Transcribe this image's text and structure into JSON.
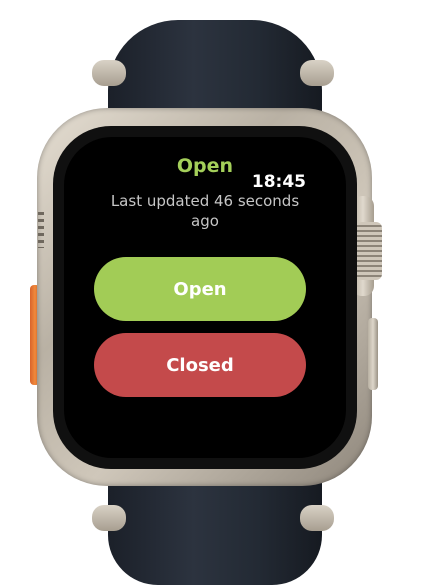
{
  "status": {
    "title": "Open",
    "clock": "18:45",
    "last_updated": "Last updated 46 seconds ago"
  },
  "buttons": {
    "open_label": "Open",
    "closed_label": "Closed"
  },
  "colors": {
    "status_text": "#a4cf5a",
    "open_button": "#a2cc56",
    "closed_button": "#c44a4b",
    "screen_background": "#000000"
  }
}
